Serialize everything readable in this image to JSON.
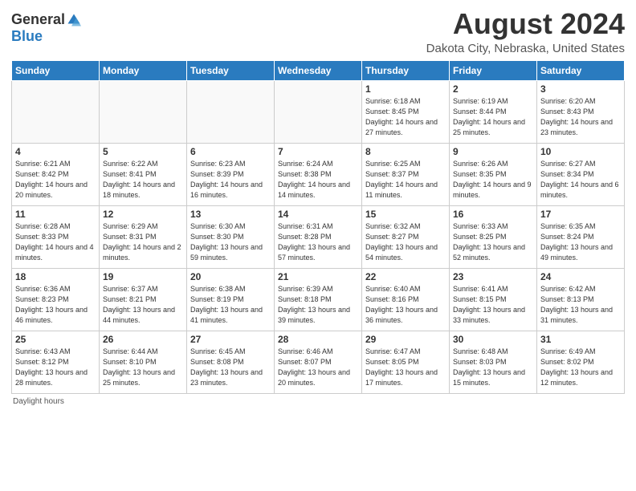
{
  "header": {
    "logo_general": "General",
    "logo_blue": "Blue",
    "month_title": "August 2024",
    "location": "Dakota City, Nebraska, United States"
  },
  "days_of_week": [
    "Sunday",
    "Monday",
    "Tuesday",
    "Wednesday",
    "Thursday",
    "Friday",
    "Saturday"
  ],
  "weeks": [
    [
      {
        "day": "",
        "sunrise": "",
        "sunset": "",
        "daylight": ""
      },
      {
        "day": "",
        "sunrise": "",
        "sunset": "",
        "daylight": ""
      },
      {
        "day": "",
        "sunrise": "",
        "sunset": "",
        "daylight": ""
      },
      {
        "day": "",
        "sunrise": "",
        "sunset": "",
        "daylight": ""
      },
      {
        "day": "1",
        "sunrise": "6:18 AM",
        "sunset": "8:45 PM",
        "daylight": "14 hours and 27 minutes."
      },
      {
        "day": "2",
        "sunrise": "6:19 AM",
        "sunset": "8:44 PM",
        "daylight": "14 hours and 25 minutes."
      },
      {
        "day": "3",
        "sunrise": "6:20 AM",
        "sunset": "8:43 PM",
        "daylight": "14 hours and 23 minutes."
      }
    ],
    [
      {
        "day": "4",
        "sunrise": "6:21 AM",
        "sunset": "8:42 PM",
        "daylight": "14 hours and 20 minutes."
      },
      {
        "day": "5",
        "sunrise": "6:22 AM",
        "sunset": "8:41 PM",
        "daylight": "14 hours and 18 minutes."
      },
      {
        "day": "6",
        "sunrise": "6:23 AM",
        "sunset": "8:39 PM",
        "daylight": "14 hours and 16 minutes."
      },
      {
        "day": "7",
        "sunrise": "6:24 AM",
        "sunset": "8:38 PM",
        "daylight": "14 hours and 14 minutes."
      },
      {
        "day": "8",
        "sunrise": "6:25 AM",
        "sunset": "8:37 PM",
        "daylight": "14 hours and 11 minutes."
      },
      {
        "day": "9",
        "sunrise": "6:26 AM",
        "sunset": "8:35 PM",
        "daylight": "14 hours and 9 minutes."
      },
      {
        "day": "10",
        "sunrise": "6:27 AM",
        "sunset": "8:34 PM",
        "daylight": "14 hours and 6 minutes."
      }
    ],
    [
      {
        "day": "11",
        "sunrise": "6:28 AM",
        "sunset": "8:33 PM",
        "daylight": "14 hours and 4 minutes."
      },
      {
        "day": "12",
        "sunrise": "6:29 AM",
        "sunset": "8:31 PM",
        "daylight": "14 hours and 2 minutes."
      },
      {
        "day": "13",
        "sunrise": "6:30 AM",
        "sunset": "8:30 PM",
        "daylight": "13 hours and 59 minutes."
      },
      {
        "day": "14",
        "sunrise": "6:31 AM",
        "sunset": "8:28 PM",
        "daylight": "13 hours and 57 minutes."
      },
      {
        "day": "15",
        "sunrise": "6:32 AM",
        "sunset": "8:27 PM",
        "daylight": "13 hours and 54 minutes."
      },
      {
        "day": "16",
        "sunrise": "6:33 AM",
        "sunset": "8:25 PM",
        "daylight": "13 hours and 52 minutes."
      },
      {
        "day": "17",
        "sunrise": "6:35 AM",
        "sunset": "8:24 PM",
        "daylight": "13 hours and 49 minutes."
      }
    ],
    [
      {
        "day": "18",
        "sunrise": "6:36 AM",
        "sunset": "8:23 PM",
        "daylight": "13 hours and 46 minutes."
      },
      {
        "day": "19",
        "sunrise": "6:37 AM",
        "sunset": "8:21 PM",
        "daylight": "13 hours and 44 minutes."
      },
      {
        "day": "20",
        "sunrise": "6:38 AM",
        "sunset": "8:19 PM",
        "daylight": "13 hours and 41 minutes."
      },
      {
        "day": "21",
        "sunrise": "6:39 AM",
        "sunset": "8:18 PM",
        "daylight": "13 hours and 39 minutes."
      },
      {
        "day": "22",
        "sunrise": "6:40 AM",
        "sunset": "8:16 PM",
        "daylight": "13 hours and 36 minutes."
      },
      {
        "day": "23",
        "sunrise": "6:41 AM",
        "sunset": "8:15 PM",
        "daylight": "13 hours and 33 minutes."
      },
      {
        "day": "24",
        "sunrise": "6:42 AM",
        "sunset": "8:13 PM",
        "daylight": "13 hours and 31 minutes."
      }
    ],
    [
      {
        "day": "25",
        "sunrise": "6:43 AM",
        "sunset": "8:12 PM",
        "daylight": "13 hours and 28 minutes."
      },
      {
        "day": "26",
        "sunrise": "6:44 AM",
        "sunset": "8:10 PM",
        "daylight": "13 hours and 25 minutes."
      },
      {
        "day": "27",
        "sunrise": "6:45 AM",
        "sunset": "8:08 PM",
        "daylight": "13 hours and 23 minutes."
      },
      {
        "day": "28",
        "sunrise": "6:46 AM",
        "sunset": "8:07 PM",
        "daylight": "13 hours and 20 minutes."
      },
      {
        "day": "29",
        "sunrise": "6:47 AM",
        "sunset": "8:05 PM",
        "daylight": "13 hours and 17 minutes."
      },
      {
        "day": "30",
        "sunrise": "6:48 AM",
        "sunset": "8:03 PM",
        "daylight": "13 hours and 15 minutes."
      },
      {
        "day": "31",
        "sunrise": "6:49 AM",
        "sunset": "8:02 PM",
        "daylight": "13 hours and 12 minutes."
      }
    ]
  ],
  "footer": {
    "daylight_hours_label": "Daylight hours"
  }
}
